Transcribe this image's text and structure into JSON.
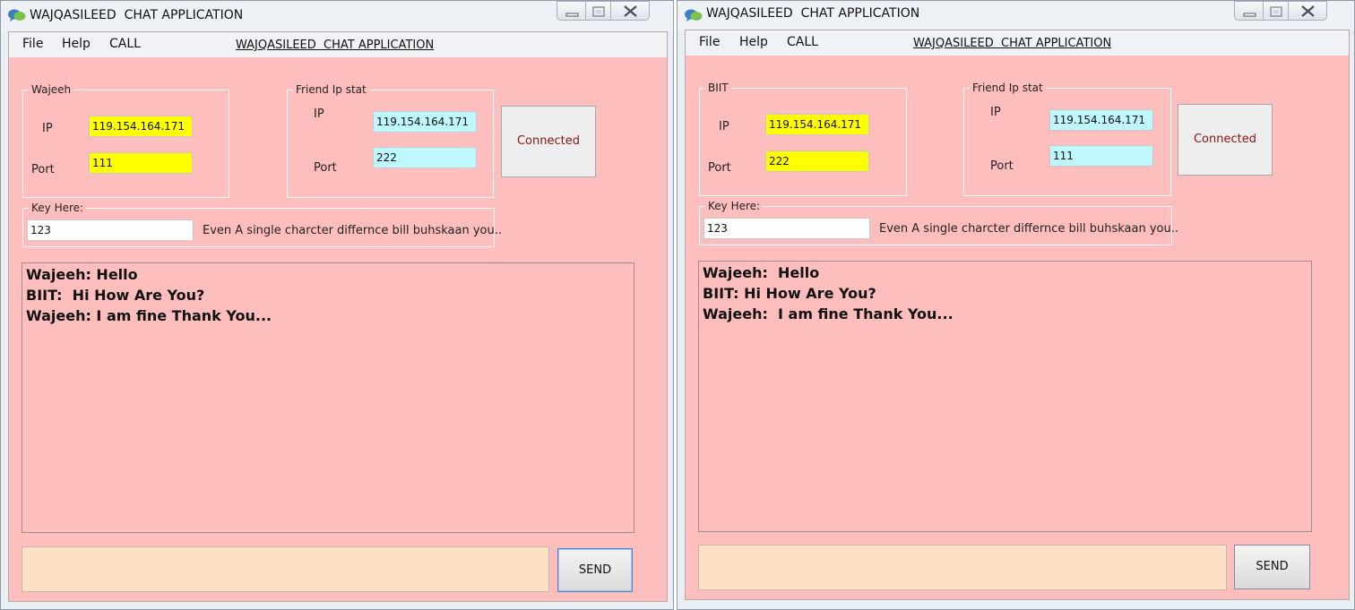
{
  "windows": [
    {
      "title": "WAJQASILEED  CHAT APPLICATION",
      "menu": {
        "file": "File",
        "help": "Help",
        "call": "CALL",
        "caption": "WAJQASILEED  CHAT APPLICATION"
      },
      "local_group": {
        "label": "Wajeeh",
        "ip_label": "IP",
        "ip_value": "119.154.164.171",
        "port_label": "Port",
        "port_value": "111"
      },
      "friend_group": {
        "label": "Friend Ip stat",
        "ip_label": "IP",
        "ip_value": "119.154.164.171",
        "port_label": "Port",
        "port_value": "222"
      },
      "connect_button": "Connected",
      "key_group": {
        "label": "Key Here:",
        "value": "123",
        "hint": "Even A single charcter differnce bill buhskaan you.."
      },
      "chat_lines": [
        "Wajeeh: Hello",
        "BIIT:  Hi How Are You?",
        "Wajeeh: I am fine Thank You..."
      ],
      "message_value": "",
      "send_button": "SEND"
    },
    {
      "title": "WAJQASILEED  CHAT APPLICATION",
      "menu": {
        "file": "File",
        "help": "Help",
        "call": "CALL",
        "caption": "WAJQASILEED  CHAT APPLICATION"
      },
      "local_group": {
        "label": "BIIT",
        "ip_label": "IP",
        "ip_value": "119.154.164.171",
        "port_label": "Port",
        "port_value": "222"
      },
      "friend_group": {
        "label": "Friend Ip stat",
        "ip_label": "IP",
        "ip_value": "119.154.164.171",
        "port_label": "Port",
        "port_value": "111"
      },
      "connect_button": "Connected",
      "key_group": {
        "label": "Key Here:",
        "value": "123",
        "hint": "Even A single charcter differnce bill buhskaan you.."
      },
      "chat_lines": [
        "Wajeeh:  Hello",
        "BIIT: Hi How Are You?",
        "Wajeeh:  I am fine Thank You..."
      ],
      "message_value": "",
      "send_button": "SEND"
    }
  ],
  "colors": {
    "client_background": "#ffbebe",
    "own_field": "#ffff00",
    "friend_field": "#bff7ff",
    "message_input": "#fde0c6",
    "connected_text": "#8b1515"
  },
  "icons": [
    "chat-bubbles-icon",
    "minimize-icon",
    "maximize-icon",
    "close-icon"
  ]
}
